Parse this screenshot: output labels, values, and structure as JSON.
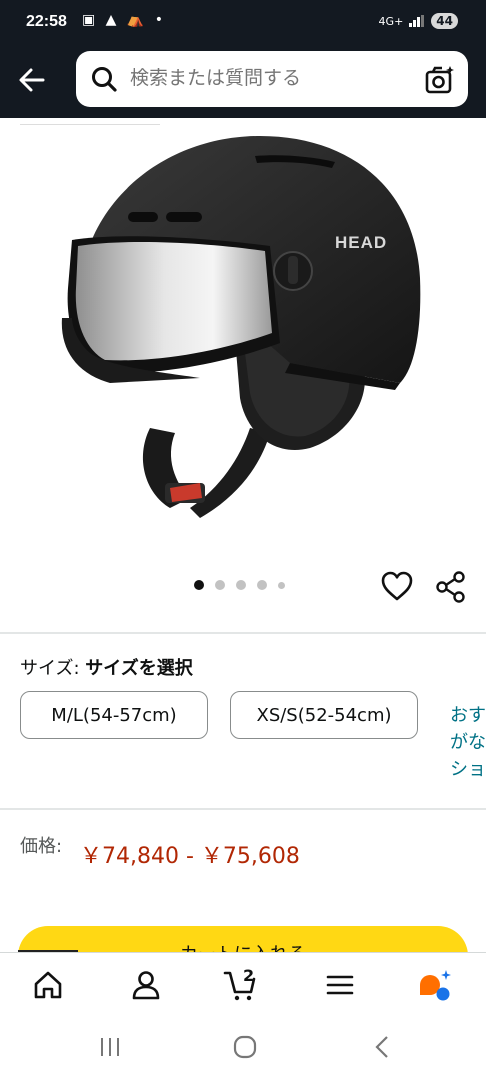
{
  "status_bar": {
    "time": "22:58",
    "left_icons": "▣ ▲ ⛺ •",
    "signal": "4G+",
    "battery": "44"
  },
  "search": {
    "placeholder": "検索または質問する"
  },
  "product": {
    "brand_on_image": "HEAD",
    "image_count": 5,
    "active_image": 1
  },
  "size": {
    "label": "サイズ:",
    "selected": "サイズを選択",
    "options": [
      "M/L(54-57cm)",
      "XS/S(52-54cm)"
    ],
    "more_link": "おすがなショ"
  },
  "price": {
    "label": "価格:",
    "value": "￥74,840 - ￥75,608"
  },
  "cart_button": {
    "label": "カートに入れる"
  },
  "bottom_nav": {
    "cart_count": "2"
  },
  "colors": {
    "header_bg": "#131921",
    "price_red": "#b12704",
    "link_teal": "#007185",
    "cart_yellow": "#ffd814",
    "rufus_orange": "#ff6f00",
    "rufus_blue": "#1a73e8"
  }
}
